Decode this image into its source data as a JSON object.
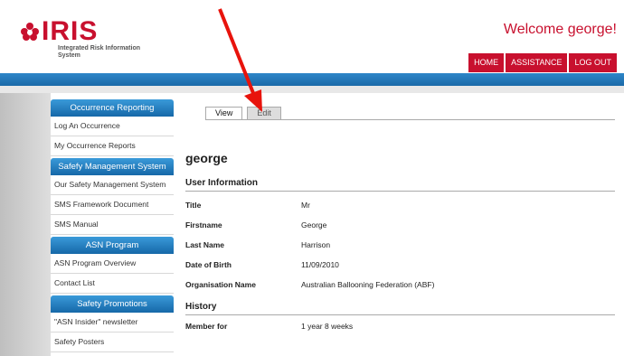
{
  "header": {
    "brand": "IRIS",
    "tagline": "Integrated Risk Information System",
    "welcome": "Welcome george!",
    "nav": [
      "HOME",
      "ASSISTANCE",
      "LOG OUT"
    ],
    "accent": "#c8102e"
  },
  "sidebar": {
    "sections": [
      {
        "title": "Occurrence Reporting",
        "items": [
          "Log An Occurrence",
          "My Occurrence Reports"
        ]
      },
      {
        "title": "Safefy Management System",
        "items": [
          "Our Safety Management System",
          "SMS Framework Document",
          "SMS Manual"
        ]
      },
      {
        "title": "ASN Program",
        "items": [
          "ASN Program Overview",
          "Contact List"
        ]
      },
      {
        "title": "Safety Promotions",
        "items": [
          "\"ASN Insider\" newsletter",
          "Safety Posters"
        ]
      }
    ]
  },
  "main": {
    "tabs": [
      "View",
      "Edit"
    ],
    "username": "george",
    "user_info": {
      "heading": "User Information",
      "fields": [
        {
          "label": "Title",
          "value": "Mr"
        },
        {
          "label": "Firstname",
          "value": "George"
        },
        {
          "label": "Last Name",
          "value": "Harrison"
        },
        {
          "label": "Date of Birth",
          "value": "11/09/2010"
        },
        {
          "label": "Organisation Name",
          "value": "Australian Ballooning Federation (ABF)"
        }
      ]
    },
    "history": {
      "heading": "History",
      "fields": [
        {
          "label": "Member for",
          "value": "1 year 8 weeks"
        }
      ]
    }
  },
  "annotation": {
    "arrow_color": "#e8130c"
  }
}
